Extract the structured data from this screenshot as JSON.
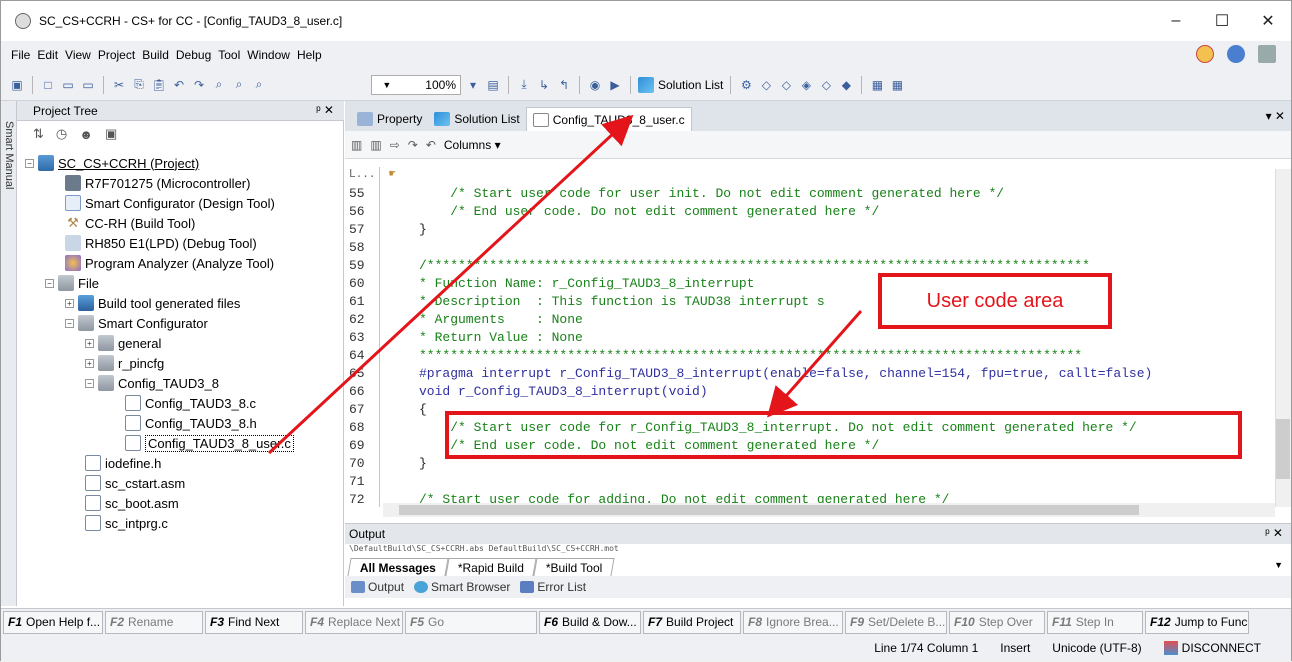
{
  "window": {
    "title": "SC_CS+CCRH - CS+ for CC - [Config_TAUD3_8_user.c]",
    "controls": [
      "–",
      "☐",
      "✕"
    ]
  },
  "menu": [
    "File",
    "Edit",
    "View",
    "Project",
    "Build",
    "Debug",
    "Tool",
    "Window",
    "Help"
  ],
  "toolbar": {
    "zoom": "100%",
    "solution_list": "Solution List"
  },
  "project_tree": {
    "header": "Project Tree",
    "pin": "ᵖ ✕",
    "side_tab": "Smart Manual",
    "items": [
      {
        "label": "SC_CS+CCRH (Project)"
      },
      {
        "label": "R7F701275 (Microcontroller)"
      },
      {
        "label": "Smart Configurator (Design Tool)"
      },
      {
        "label": "CC-RH (Build Tool)"
      },
      {
        "label": "RH850 E1(LPD) (Debug Tool)"
      },
      {
        "label": "Program Analyzer (Analyze Tool)"
      },
      {
        "label": "File"
      },
      {
        "label": "Build tool generated files"
      },
      {
        "label": "Smart Configurator"
      },
      {
        "label": "general"
      },
      {
        "label": "r_pincfg"
      },
      {
        "label": "Config_TAUD3_8"
      },
      {
        "label": "Config_TAUD3_8.c"
      },
      {
        "label": "Config_TAUD3_8.h"
      },
      {
        "label": "Config_TAUD3_8_user.c"
      },
      {
        "label": "iodefine.h"
      },
      {
        "label": "sc_cstart.asm"
      },
      {
        "label": "sc_boot.asm"
      },
      {
        "label": "sc_intprg.c"
      }
    ]
  },
  "doc_tabs": [
    "Property",
    "Solution List",
    "Config_TAUD3_8_user.c"
  ],
  "doc_toolbar": {
    "columns": "Columns"
  },
  "editor": {
    "header_left": "L...",
    "lines": [
      {
        "no": "55",
        "text": "    /* Start user code for user init. Do not edit comment generated here */"
      },
      {
        "no": "56",
        "text": "    /* End user code. Do not edit comment generated here */"
      },
      {
        "no": "57",
        "text": "}"
      },
      {
        "no": "58",
        "text": ""
      },
      {
        "no": "59",
        "text": "/*************************************************************************************"
      },
      {
        "no": "60",
        "text": "* Function Name: r_Config_TAUD3_8_interrupt"
      },
      {
        "no": "61",
        "text": "* Description  : This function is TAUD38 interrupt s"
      },
      {
        "no": "62",
        "text": "* Arguments    : None"
      },
      {
        "no": "63",
        "text": "* Return Value : None"
      },
      {
        "no": "64",
        "text": "*************************************************************************************"
      },
      {
        "no": "65",
        "text": "#pragma interrupt r_Config_TAUD3_8_interrupt(enable=false, channel=154, fpu=true, callt=false)"
      },
      {
        "no": "66",
        "text": "void r_Config_TAUD3_8_interrupt(void)"
      },
      {
        "no": "67",
        "text": "{"
      },
      {
        "no": "68",
        "text": "    /* Start user code for r_Config_TAUD3_8_interrupt. Do not edit comment generated here */"
      },
      {
        "no": "69",
        "text": "    /* End user code. Do not edit comment generated here */"
      },
      {
        "no": "70",
        "text": "}"
      },
      {
        "no": "71",
        "text": ""
      },
      {
        "no": "72",
        "text": "/* Start user code for adding. Do not edit comment generated here */"
      }
    ]
  },
  "annotation": {
    "label": "User code area"
  },
  "output": {
    "header": "Output",
    "path": "\\DefaultBuild\\SC_CS+CCRH.abs DefaultBuild\\SC_CS+CCRH.mot",
    "tabs": [
      "All Messages",
      "*Rapid Build",
      "*Build Tool"
    ],
    "bottom_tabs": [
      "Output",
      "Smart Browser",
      "Error List"
    ]
  },
  "fn_keys": [
    {
      "key": "F1",
      "label": "Open Help f...",
      "enabled": true
    },
    {
      "key": "F2",
      "label": "Rename",
      "enabled": false
    },
    {
      "key": "F3",
      "label": "Find Next",
      "enabled": true
    },
    {
      "key": "F4",
      "label": "Replace Next",
      "enabled": false
    },
    {
      "key": "F5",
      "label": "Go",
      "enabled": false
    },
    {
      "key": "F6",
      "label": "Build & Dow...",
      "enabled": true
    },
    {
      "key": "F7",
      "label": "Build Project",
      "enabled": true
    },
    {
      "key": "F8",
      "label": "Ignore Brea...",
      "enabled": false
    },
    {
      "key": "F9",
      "label": "Set/Delete B...",
      "enabled": false
    },
    {
      "key": "F10",
      "label": "Step Over",
      "enabled": false
    },
    {
      "key": "F11",
      "label": "Step In",
      "enabled": false
    },
    {
      "key": "F12",
      "label": "Jump to Func...",
      "enabled": true
    }
  ],
  "status": {
    "position": "Line 1/74  Column 1",
    "mode": "Insert",
    "encoding": "Unicode (UTF-8)",
    "connection": "DISCONNECT"
  },
  "colors": {
    "annotation": "#e3141a",
    "comment": "#188218"
  }
}
